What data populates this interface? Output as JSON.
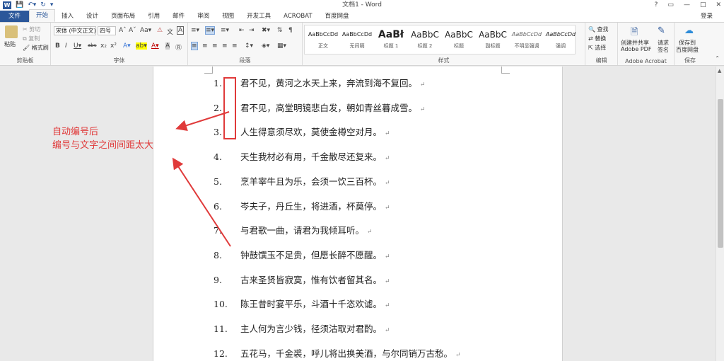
{
  "window": {
    "title": "文档1 - Word",
    "help": "?",
    "login": "登录"
  },
  "quick_access": {
    "logo": "W",
    "save_icon": "save-icon",
    "undo_icon": "undo-icon",
    "redo_icon": "redo-icon"
  },
  "tabs": [
    "文件",
    "开始",
    "插入",
    "设计",
    "页面布局",
    "引用",
    "邮件",
    "审阅",
    "视图",
    "开发工具",
    "ACROBAT",
    "百度网盘"
  ],
  "ribbon": {
    "clipboard": {
      "paste": "粘贴",
      "cut": "剪切",
      "copy": "复制",
      "format_painter": "格式刷",
      "label": "剪贴板"
    },
    "font": {
      "font_name": "宋体 (中文正文)",
      "font_size": "四号",
      "label": "字体"
    },
    "paragraph": {
      "label": "段落"
    },
    "styles": {
      "label": "样式",
      "items": [
        {
          "preview": "AaBbCcDd",
          "name": "正文"
        },
        {
          "preview": "AaBbCcDd",
          "name": "无间隔"
        },
        {
          "preview": "AaBł",
          "name": "标题 1"
        },
        {
          "preview": "AaBbC",
          "name": "标题 2"
        },
        {
          "preview": "AaBbC",
          "name": "标题"
        },
        {
          "preview": "AaBbC",
          "name": "副标题"
        },
        {
          "preview": "AaBbCcDd",
          "name": "不明显强调"
        },
        {
          "preview": "AaBbCcDd",
          "name": "强调"
        }
      ]
    },
    "editing": {
      "find": "查找",
      "replace": "替换",
      "select": "选择",
      "label": "编辑"
    },
    "acrobat": {
      "create_share_1": "创建并共享",
      "create_share_2": "Adobe PDF",
      "request_1": "请求",
      "request_2": "签名",
      "label": "Adobe Acrobat"
    },
    "save": {
      "save_1": "保存到",
      "save_2": "百度网盘",
      "label": "保存"
    }
  },
  "document": {
    "lines": [
      {
        "num": "1.",
        "text": "君不见，黄河之水天上来，奔流到海不复回。"
      },
      {
        "num": "2.",
        "text": "君不见，高堂明镜悲白发，朝如青丝暮成雪。"
      },
      {
        "num": "3.",
        "text": "人生得意须尽欢，莫使金樽空对月。"
      },
      {
        "num": "4.",
        "text": "天生我材必有用，千金散尽还复来。"
      },
      {
        "num": "5.",
        "text": "烹羊宰牛且为乐，会须一饮三百杯。"
      },
      {
        "num": "6.",
        "text": "岑夫子，丹丘生，将进酒，杯莫停。"
      },
      {
        "num": "7.",
        "text": "与君歌一曲，请君为我倾耳听。"
      },
      {
        "num": "8.",
        "text": "钟鼓馔玉不足贵，但愿长醉不愿醒。"
      },
      {
        "num": "9.",
        "text": "古来圣贤皆寂寞，惟有饮者留其名。"
      },
      {
        "num": "10.",
        "text": "陈王昔时宴平乐，斗酒十千恣欢谑。"
      },
      {
        "num": "11.",
        "text": "主人何为言少钱，径须沽取对君酌。"
      },
      {
        "num": "12.",
        "text": "五花马，千金裘，呼儿将出换美酒，与尔同销万古愁。"
      }
    ],
    "para_mark": "↵"
  },
  "annotation": {
    "line1": "自动编号后",
    "line2": "编号与文字之间间距太大",
    "color": "#e03a3a"
  }
}
